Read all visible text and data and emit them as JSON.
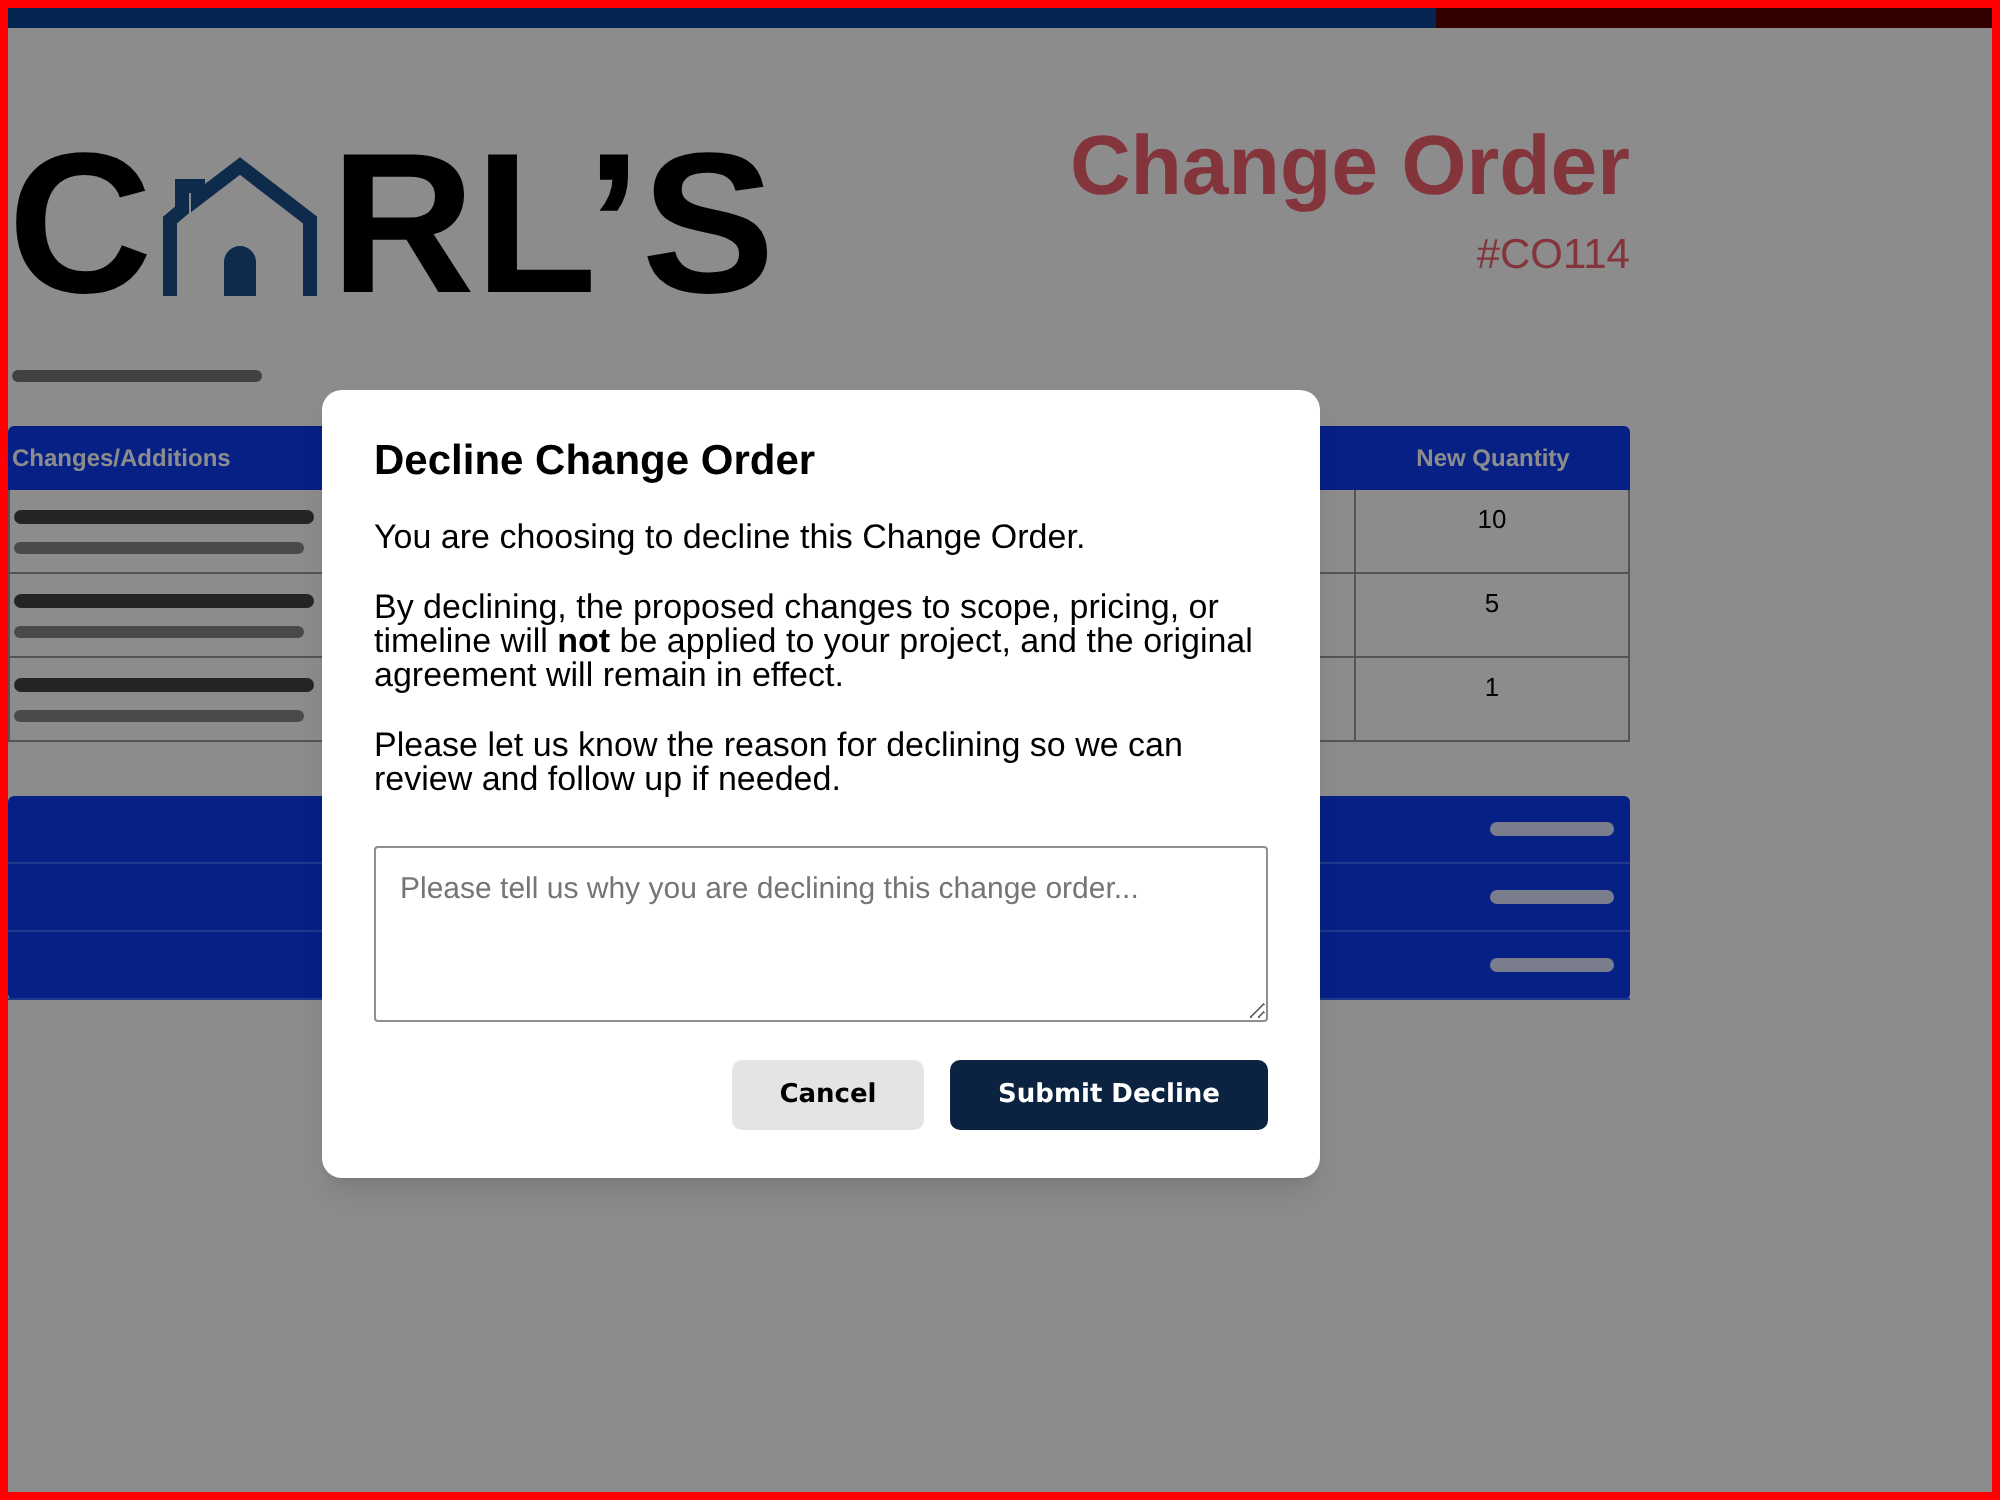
{
  "logo": {
    "text_start": "C",
    "text_end": "RL’S"
  },
  "header": {
    "title": "Change Order",
    "number": "#CO114"
  },
  "table": {
    "columns": [
      {
        "label": "Changes/Additions"
      },
      {
        "label": "New Quantity"
      }
    ],
    "rows": [
      {
        "new_quantity": "10"
      },
      {
        "new_quantity": "5"
      },
      {
        "new_quantity": "1"
      }
    ]
  },
  "dialog": {
    "title": "Decline Change Order",
    "paragraphs": [
      "You are choosing to decline this Change Order.",
      "By declining, the proposed changes to scope, pricing, or timeline will **not** be applied to your project, and the original agreement will remain in effect.",
      "Please let us know the reason for declining so we can review and follow up if needed."
    ],
    "reason_field": {
      "placeholder": "Please tell us why you are declining this change order..."
    },
    "buttons": [
      {
        "label": "Cancel",
        "kind": "secondary"
      },
      {
        "label": "Submit Decline",
        "kind": "primary"
      }
    ]
  }
}
